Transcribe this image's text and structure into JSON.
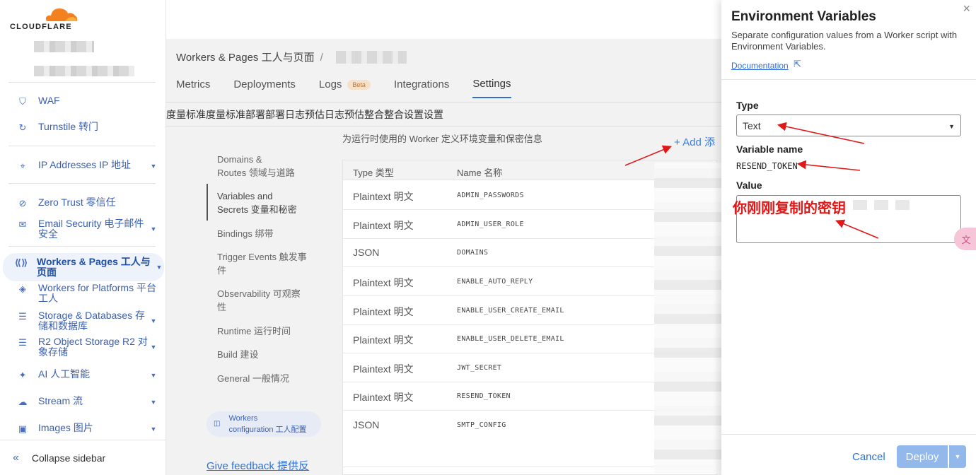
{
  "brand": {
    "logo_text": "CLOUDFLARE"
  },
  "sidebar": {
    "items": [
      {
        "label": "WAF",
        "icon": "shield-icon"
      },
      {
        "label": "Turnstile  转门",
        "icon": "refresh-icon"
      },
      {
        "label": "IP Addresses  IP 地址",
        "icon": "location-pin-icon"
      },
      {
        "label": "Zero Trust  零信任",
        "icon": "zero-trust-icon"
      },
      {
        "label": "Email Security  电子邮件安全",
        "icon": "mail-icon"
      },
      {
        "label": "Workers & Pages  工人与页面",
        "icon": "workers-icon"
      },
      {
        "label": "Workers for Platforms  平台工人",
        "icon": "cube-icon"
      },
      {
        "label": "Storage & Databases  存储和数据库",
        "icon": "database-icon"
      },
      {
        "label": "R2 Object Storage  R2 对象存储",
        "icon": "database-icon"
      },
      {
        "label": "AI  人工智能",
        "icon": "ai-icon"
      },
      {
        "label": "Stream  流",
        "icon": "cloud-icon"
      },
      {
        "label": "Images  图片",
        "icon": "image-icon"
      }
    ],
    "collapse_label": "Collapse sidebar"
  },
  "header": {
    "breadcrumb": "Workers & Pages  工人与页面",
    "breadcrumb_sep": "/"
  },
  "tabs": [
    {
      "label": "Metrics"
    },
    {
      "label": "Deployments"
    },
    {
      "label": "Logs",
      "badge": "Beta"
    },
    {
      "label": "Integrations"
    },
    {
      "label": "Settings"
    }
  ],
  "garbled_tabs": "度量标准度量标准部署部署日志预估日志预估整合整合设置设置",
  "subnav": [
    {
      "label": "Domains &\nRoutes  领域与道路"
    },
    {
      "label": "Variables and\nSecrets  变量和秘密"
    },
    {
      "label": "Bindings  绑带"
    },
    {
      "label": "Trigger Events  触发事\n件"
    },
    {
      "label": "Observability  可观察\n性"
    },
    {
      "label": "Runtime  运行时间"
    },
    {
      "label": "Build  建设"
    },
    {
      "label": "General  一般情况"
    }
  ],
  "workers_config": "Workers\nconfiguration  工人配置",
  "feedback": "Give feedback  提供反",
  "variables": {
    "description": "为运行时使用的 Worker 定义环境变量和保密信息",
    "add_label": "+ Add  添",
    "columns": {
      "type": "Type  类型",
      "name": "Name  名称"
    },
    "rows": [
      {
        "type": "Plaintext  明文",
        "name": "ADMIN_PASSWORDS"
      },
      {
        "type": "Plaintext  明文",
        "name": "ADMIN_USER_ROLE"
      },
      {
        "type": "JSON",
        "name": "DOMAINS"
      },
      {
        "type": "Plaintext  明文",
        "name": "ENABLE_AUTO_REPLY"
      },
      {
        "type": "Plaintext  明文",
        "name": "ENABLE_USER_CREATE_EMAIL"
      },
      {
        "type": "Plaintext  明文",
        "name": "ENABLE_USER_DELETE_EMAIL"
      },
      {
        "type": "Plaintext  明文",
        "name": "JWT_SECRET"
      },
      {
        "type": "Plaintext  明文",
        "name": "RESEND_TOKEN"
      },
      {
        "type": "JSON",
        "name": "SMTP_CONFIG"
      }
    ]
  },
  "panel": {
    "title": "Environment Variables",
    "close": "×",
    "description": "Separate configuration values from a Worker script with Environment Variables.",
    "doc_link": "Documentation",
    "type_label": "Type",
    "type_value": "Text",
    "varname_label": "Variable name",
    "varname_value": "RESEND_TOKEN",
    "value_label": "Value",
    "value_annotation": "你刚刚复制的密钥",
    "cancel": "Cancel",
    "deploy": "Deploy"
  },
  "colors": {
    "accent": "#2f6ed6",
    "annotation": "#e01818",
    "deploy_disabled": "#93b8ec"
  }
}
